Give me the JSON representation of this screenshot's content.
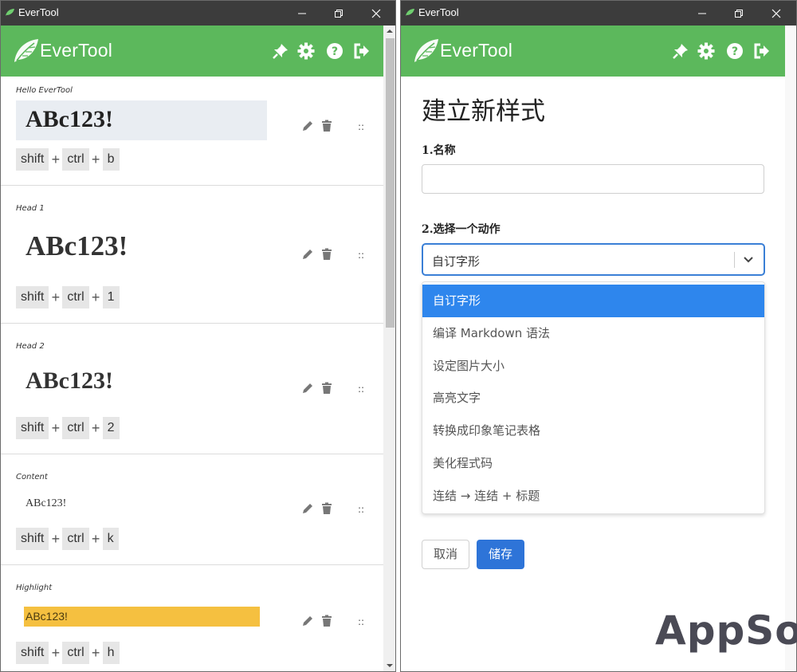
{
  "left_window": {
    "title": "EverTool",
    "app_name": "EverTool",
    "cards": [
      {
        "name": "Hello EverTool",
        "sample": "ABc123!",
        "keys": [
          "shift",
          "ctrl",
          "b"
        ]
      },
      {
        "name": "Head 1",
        "sample": "ABc123!",
        "keys": [
          "shift",
          "ctrl",
          "1"
        ]
      },
      {
        "name": "Head 2",
        "sample": "ABc123!",
        "keys": [
          "shift",
          "ctrl",
          "2"
        ]
      },
      {
        "name": "Content",
        "sample": "ABc123!",
        "keys": [
          "shift",
          "ctrl",
          "k"
        ]
      },
      {
        "name": "Highlight",
        "sample": "ABc123!",
        "keys": [
          "shift",
          "ctrl",
          "h"
        ]
      }
    ],
    "plus": "+",
    "drag_glyph": "::"
  },
  "right_window": {
    "title": "EverTool",
    "app_name": "EverTool",
    "form_title": "建立新样式",
    "name_label": "1.名称",
    "name_value": "",
    "action_label": "2.选择一个动作",
    "action_selected": "自订字形",
    "options": [
      "自订字形",
      "编译 Markdown 语法",
      "设定图片大小",
      "高亮文字",
      "转换成印象笔记表格",
      "美化程式码",
      "连结 → 连结 + 标题"
    ],
    "cancel_label": "取消",
    "save_label": "储存"
  },
  "watermark": "AppSo",
  "colors": {
    "app_bar": "#5cb85c",
    "title_bar": "#3c3c3c",
    "select_border": "#3a7fd6",
    "selected_option": "#2e86ed",
    "save_button": "#2e74d8",
    "highlight": "#f5c040",
    "hello_bg": "#e9edf2"
  },
  "icons": [
    "leaf-icon",
    "pin-icon",
    "gear-icon",
    "help-icon",
    "sign-out-icon",
    "pencil-icon",
    "trash-icon",
    "drag-handle-icon",
    "chevron-down-icon",
    "minimize-icon",
    "restore-icon",
    "close-icon"
  ]
}
